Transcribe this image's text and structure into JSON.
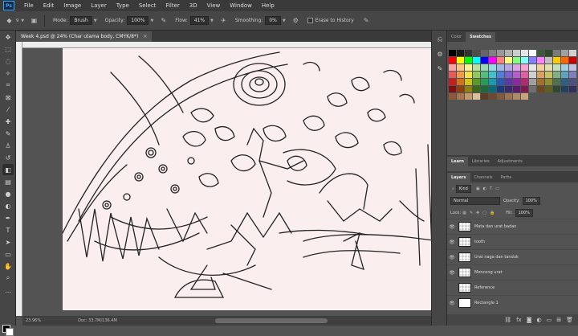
{
  "menubar": {
    "logo": "Ps",
    "items": [
      "File",
      "Edit",
      "Image",
      "Layer",
      "Type",
      "Select",
      "Filter",
      "3D",
      "View",
      "Window",
      "Help"
    ]
  },
  "options": {
    "brush_size": "9",
    "mode_label": "Mode:",
    "mode_value": "Brush",
    "opacity_label": "Opacity:",
    "opacity_value": "100%",
    "flow_label": "Flow:",
    "flow_value": "41%",
    "smoothing_label": "Smoothing:",
    "smoothing_value": "0%",
    "erase_history_label": "Erase to History"
  },
  "document": {
    "tab_title": "Week 4.psd @ 24% (Char utama body, CMYK/8*)",
    "close": "×"
  },
  "status": {
    "zoom": "23.96%",
    "doc": "Doc: 33.7M/136.4M"
  },
  "swatch_panel": {
    "tabs": [
      "Color",
      "Swatches"
    ],
    "active_tab": "Swatches",
    "colors": [
      "#000000",
      "#1a1a1a",
      "#333333",
      "#4d4d4d",
      "#666666",
      "#808080",
      "#999999",
      "#b3b3b3",
      "#cccccc",
      "#e6e6e6",
      "#ffffff",
      "#3b5a3b",
      "#2f4a2f",
      "#7a7a7a",
      "#a0a0a0",
      "#d0d0d0",
      "#ff0000",
      "#ffff00",
      "#00ff00",
      "#00ffff",
      "#0000ff",
      "#ff00ff",
      "#ff8080",
      "#ffff80",
      "#80ff80",
      "#80ffff",
      "#8080ff",
      "#ff80ff",
      "#c0c0c0",
      "#ffcc00",
      "#ff6600",
      "#cc0000",
      "#f4a6a6",
      "#f6c58a",
      "#f9f09a",
      "#b8e0a0",
      "#9ad7b4",
      "#95d9e2",
      "#9fb7e6",
      "#b6a6e3",
      "#d7a6e3",
      "#f3a6cf",
      "#e6e6e6",
      "#f0d0a0",
      "#e0e0b0",
      "#c0e0c0",
      "#a0d0e0",
      "#c0c0e0",
      "#e85a5a",
      "#ef9b4a",
      "#f3e34a",
      "#8fc95a",
      "#4fbf7a",
      "#3fbfcf",
      "#4f7fd9",
      "#7f5fd0",
      "#b45fd0",
      "#e05fa0",
      "#d0d0d0",
      "#d9a060",
      "#c9c060",
      "#80b080",
      "#60a0c0",
      "#8080c0",
      "#c02020",
      "#d07020",
      "#d0c020",
      "#5a9a2a",
      "#2a9a5a",
      "#1a9aaa",
      "#2a5ab0",
      "#5a3aa0",
      "#8a2aa0",
      "#b02a70",
      "#a0a0a0",
      "#a07030",
      "#909030",
      "#507050",
      "#306080",
      "#505080",
      "#801010",
      "#904010",
      "#908010",
      "#3a6a1a",
      "#1a6a3a",
      "#0a6a7a",
      "#1a3a80",
      "#3a2a70",
      "#5a1a70",
      "#801a50",
      "#707070",
      "#704820",
      "#606020",
      "#304830",
      "#204060",
      "#303060",
      "#8b5a3c",
      "#a6764f",
      "#c09a6e",
      "#d9c09a",
      "#5c3d2a",
      "#6b4a34",
      "#7d5a40",
      "#9a7452",
      "#b08a66",
      "#c8a47c"
    ]
  },
  "layers_panel": {
    "top_tabs": [
      "Learn",
      "Libraries",
      "Adjustments"
    ],
    "active_top": "Learn",
    "tabs": [
      "Layers",
      "Channels",
      "Paths"
    ],
    "active_tab": "Layers",
    "filter": "Kind",
    "blend": "Normal",
    "opacity_label": "Opacity:",
    "opacity_value": "100%",
    "lock_label": "Lock:",
    "fill_label": "Fill:",
    "fill_value": "100%",
    "layers": [
      {
        "name": "Mata dan urat badan",
        "visible": true
      },
      {
        "name": "tooth",
        "visible": true
      },
      {
        "name": "Urat naga dan tanduk",
        "visible": true
      },
      {
        "name": "Moncong urat",
        "visible": true
      },
      {
        "name": "Reference",
        "visible": false
      },
      {
        "name": "Rectangle 1",
        "visible": true
      }
    ]
  }
}
